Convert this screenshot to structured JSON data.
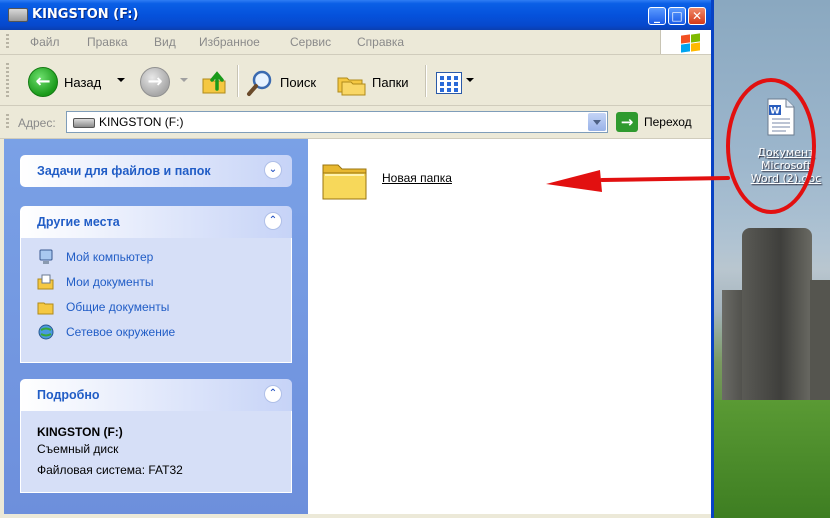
{
  "window": {
    "title": "KINGSTON (F:)"
  },
  "menu": [
    "Файл",
    "Правка",
    "Вид",
    "Избранное",
    "Сервис",
    "Справка"
  ],
  "toolbar": {
    "back_label": "Назад",
    "search_label": "Поиск",
    "folders_label": "Папки"
  },
  "address": {
    "label": "Адрес:",
    "value": "KINGSTON (F:)",
    "go_label": "Переход"
  },
  "tasks": {
    "file_tasks_title": "Задачи для файлов и папок",
    "other_places_title": "Другие места",
    "other_places": [
      {
        "label": "Мой компьютер",
        "icon": "my-computer-icon"
      },
      {
        "label": "Мои документы",
        "icon": "my-documents-icon"
      },
      {
        "label": "Общие документы",
        "icon": "shared-documents-icon"
      },
      {
        "label": "Сетевое окружение",
        "icon": "network-icon"
      }
    ],
    "details_title": "Подробно",
    "details": {
      "name": "KINGSTON (F:)",
      "type": "Съемный диск",
      "filesystem": "Файловая система: FAT32"
    }
  },
  "content": {
    "items": [
      {
        "label": "Новая папка",
        "icon": "folder-icon"
      }
    ]
  },
  "desktop": {
    "icon_label": "Документ Microsoft Word (2).doc",
    "icon": "word-document-icon"
  },
  "colors": {
    "titlebar": "#0552dc",
    "taskpane": "#7aa1e6",
    "link": "#215dc6",
    "annotation_red": "#e21010"
  }
}
